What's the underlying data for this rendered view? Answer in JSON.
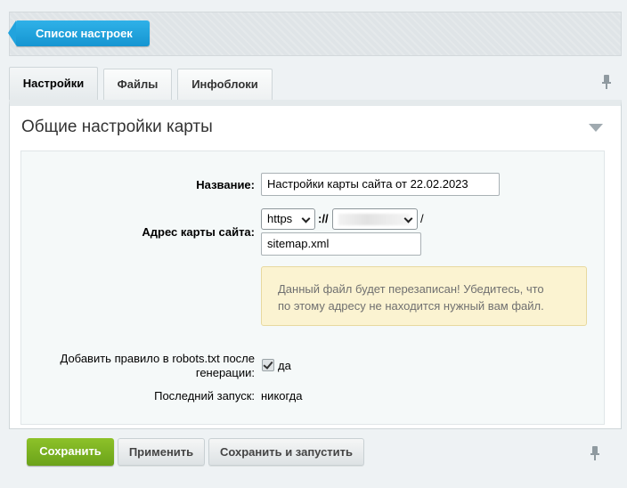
{
  "header": {
    "back_button_label": "Список настроек"
  },
  "tabs": [
    {
      "label": "Настройки",
      "active": true
    },
    {
      "label": "Файлы",
      "active": false
    },
    {
      "label": "Инфоблоки",
      "active": false
    }
  ],
  "section": {
    "title": "Общие настройки карты"
  },
  "form": {
    "name_label": "Название:",
    "name_value": "Настройки карты сайта от 22.02.2023",
    "address_label": "Адрес карты сайта:",
    "protocol_value": "https",
    "protocol_separator": "://",
    "path_separator": "/",
    "filename_value": "sitemap.xml",
    "notice_line1": "Данный файл будет перезаписан! Убедитесь, что",
    "notice_line2": "по этому адресу не находится нужный вам файл.",
    "robots_label_line1": "Добавить правило в robots.txt после",
    "robots_label_line2": "генерации:",
    "robots_checked": true,
    "robots_value_label": "да",
    "last_run_label": "Последний запуск:",
    "last_run_value": "никогда"
  },
  "buttons": {
    "save": "Сохранить",
    "apply": "Применить",
    "save_and_run": "Сохранить и запустить"
  },
  "colors": {
    "accent_blue": "#1ba0dc",
    "save_green": "#7ab321",
    "notice_bg": "#fbf3d1"
  }
}
